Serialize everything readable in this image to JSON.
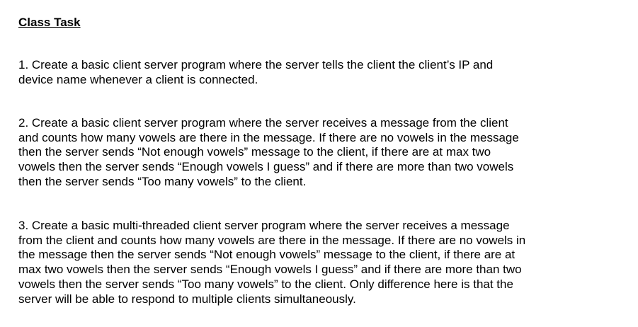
{
  "title": "Class Task",
  "tasks": [
    {
      "lines": [
        "1. Create a basic client server program where the server tells the client the client’s IP and",
        "device name whenever a client is connected."
      ]
    },
    {
      "lines": [
        "2. Create a basic client server program where the server receives a message from the client",
        "and counts how many vowels are there in the message. If there are no vowels in the message",
        "then the server sends “Not enough vowels” message to the client, if there are at max two",
        "vowels then the server sends “Enough vowels I guess” and if there are more than two vowels",
        "then the server sends “Too many vowels” to the client."
      ]
    },
    {
      "lines": [
        "3. Create a basic multi-threaded client server program where the server receives a message",
        "from the client and counts how many vowels are there in the message. If there are no vowels in",
        "the message then the server sends “Not enough vowels” message to the client, if there are at",
        "max two vowels then the server sends “Enough vowels I guess” and if there are more than two",
        "vowels then the server sends “Too many vowels” to the client. Only difference here is that the",
        "server will be able to respond to multiple clients simultaneously."
      ]
    }
  ]
}
